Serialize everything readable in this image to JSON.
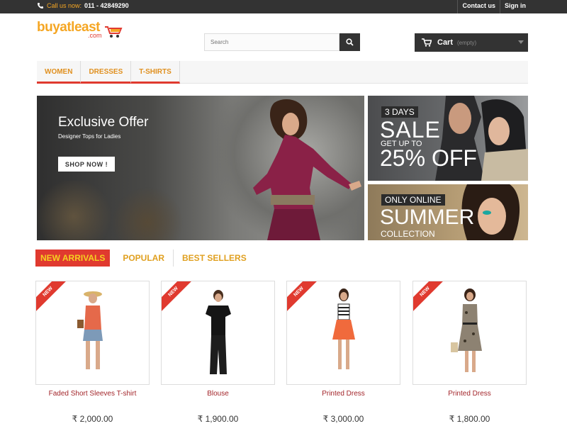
{
  "topbar": {
    "call_label": "Call us now:",
    "phone": "011 - 42849290",
    "links": [
      "Contact us",
      "Sign in"
    ]
  },
  "logo": {
    "main": "buyatleast",
    "sub": ".com"
  },
  "search": {
    "placeholder": "Search"
  },
  "cart": {
    "label": "Cart",
    "status": "(empty)"
  },
  "nav": {
    "items": [
      "WOMEN",
      "DRESSES",
      "T-SHIRTS"
    ]
  },
  "banners": {
    "main": {
      "title": "Exclusive Offer",
      "subtitle": "Designer Tops for Ladies",
      "button": "SHOP NOW !"
    },
    "sale": {
      "badge": "3 DAYS",
      "headline": "SALE",
      "upto": "GET UP TO",
      "percent": "25% OFF"
    },
    "summer": {
      "badge": "ONLY ONLINE",
      "headline": "SUMMER",
      "sub": "COLLECTION"
    }
  },
  "tabs": [
    "NEW ARRIVALS",
    "POPULAR",
    "BEST SELLERS"
  ],
  "products": [
    {
      "badge": "NEW",
      "name": "Faded Short Sleeves T-shirt",
      "price": "₹ 2,000.00"
    },
    {
      "badge": "NEW",
      "name": "Blouse",
      "price": "₹ 1,900.00"
    },
    {
      "badge": "NEW",
      "name": "Printed Dress",
      "price": "₹ 3,000.00"
    },
    {
      "badge": "NEW",
      "name": "Printed Dress",
      "price": "₹ 1,800.00"
    }
  ],
  "colors": {
    "accent": "#e03a2f",
    "brand": "#f5a623",
    "dark": "#333333",
    "product_name": "#a3262b"
  },
  "icons": [
    "phone-icon",
    "search-icon",
    "cart-icon",
    "chevron-down-icon"
  ]
}
